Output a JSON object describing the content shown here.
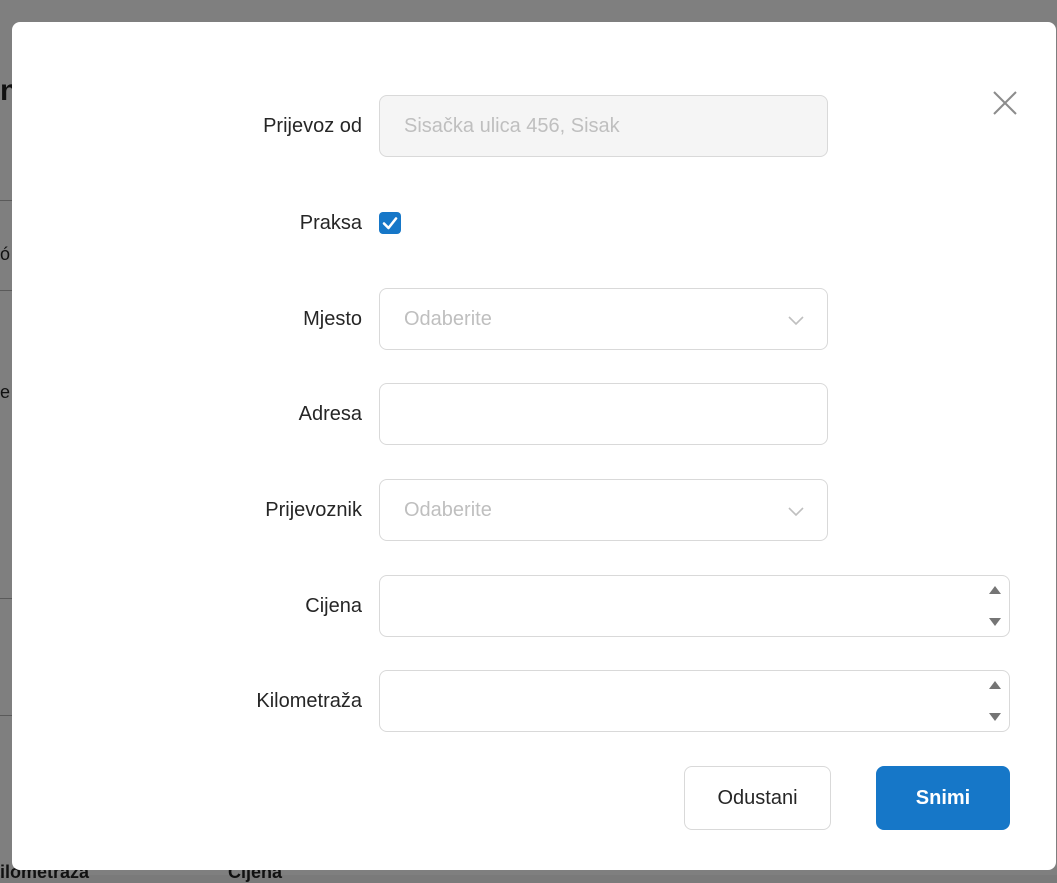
{
  "background": {
    "fragments": [
      "n",
      "ó",
      "e",
      "ilometraža",
      "Cijena"
    ]
  },
  "modal": {
    "close_icon": "close-icon",
    "fields": {
      "prijevoz_od": {
        "label": "Prijevoz od",
        "value": "Sisačka ulica 456, Sisak",
        "disabled": true
      },
      "praksa": {
        "label": "Praksa",
        "checked": true
      },
      "mjesto": {
        "label": "Mjesto",
        "placeholder": "Odaberite"
      },
      "adresa": {
        "label": "Adresa",
        "value": ""
      },
      "prijevoznik": {
        "label": "Prijevoznik",
        "placeholder": "Odaberite"
      },
      "cijena": {
        "label": "Cijena",
        "value": ""
      },
      "kilometraza": {
        "label": "Kilometraža",
        "value": ""
      }
    },
    "buttons": {
      "cancel_label": "Odustani",
      "save_label": "Snimi"
    }
  },
  "colors": {
    "primary": "#1677c8",
    "border": "#d9d9d9",
    "placeholder": "#bfbfbf",
    "disabled_bg": "#f5f5f5",
    "overlay": "#7f7f7f"
  }
}
